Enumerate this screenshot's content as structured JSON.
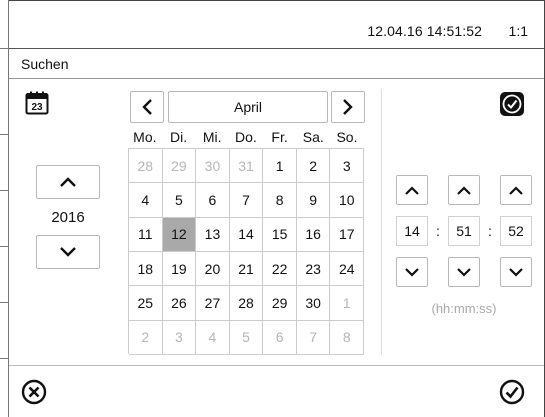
{
  "status": {
    "datetime": "12.04.16 14:51:52",
    "ratio": "1:1"
  },
  "title": "Suchen",
  "icons": {
    "calendar": "calendar-icon",
    "clock": "clock-icon",
    "cancel": "cancel-x-icon",
    "confirm": "confirm-check-icon"
  },
  "year": {
    "value": "2016"
  },
  "calendar": {
    "month": "April",
    "weekdays": [
      "Mo.",
      "Di.",
      "Mi.",
      "Do.",
      "Fr.",
      "Sa.",
      "So."
    ],
    "weeks": [
      [
        {
          "d": "28",
          "muted": true
        },
        {
          "d": "29",
          "muted": true
        },
        {
          "d": "30",
          "muted": true
        },
        {
          "d": "31",
          "muted": true
        },
        {
          "d": "1",
          "muted": false
        },
        {
          "d": "2",
          "muted": false
        },
        {
          "d": "3",
          "muted": false
        }
      ],
      [
        {
          "d": "4",
          "muted": false
        },
        {
          "d": "5",
          "muted": false
        },
        {
          "d": "6",
          "muted": false
        },
        {
          "d": "7",
          "muted": false
        },
        {
          "d": "8",
          "muted": false
        },
        {
          "d": "9",
          "muted": false
        },
        {
          "d": "10",
          "muted": false
        }
      ],
      [
        {
          "d": "11",
          "muted": false
        },
        {
          "d": "12",
          "muted": false,
          "selected": true
        },
        {
          "d": "13",
          "muted": false
        },
        {
          "d": "14",
          "muted": false
        },
        {
          "d": "15",
          "muted": false
        },
        {
          "d": "16",
          "muted": false
        },
        {
          "d": "17",
          "muted": false
        }
      ],
      [
        {
          "d": "18",
          "muted": false
        },
        {
          "d": "19",
          "muted": false
        },
        {
          "d": "20",
          "muted": false
        },
        {
          "d": "21",
          "muted": false
        },
        {
          "d": "22",
          "muted": false
        },
        {
          "d": "23",
          "muted": false
        },
        {
          "d": "24",
          "muted": false
        }
      ],
      [
        {
          "d": "25",
          "muted": false
        },
        {
          "d": "26",
          "muted": false
        },
        {
          "d": "27",
          "muted": false
        },
        {
          "d": "28",
          "muted": false
        },
        {
          "d": "29",
          "muted": false
        },
        {
          "d": "30",
          "muted": false
        },
        {
          "d": "1",
          "muted": true
        }
      ],
      [
        {
          "d": "2",
          "muted": true
        },
        {
          "d": "3",
          "muted": true
        },
        {
          "d": "4",
          "muted": true
        },
        {
          "d": "5",
          "muted": true
        },
        {
          "d": "6",
          "muted": true
        },
        {
          "d": "7",
          "muted": true
        },
        {
          "d": "8",
          "muted": true
        }
      ]
    ]
  },
  "time": {
    "hh": "14",
    "mm": "51",
    "ss": "52",
    "separator": ":",
    "format_hint": "(hh:mm:ss)"
  },
  "colors": {
    "selected_day": "#a9a9a9",
    "muted_day": "#b6b6b6",
    "border": "#b8b8b8"
  }
}
